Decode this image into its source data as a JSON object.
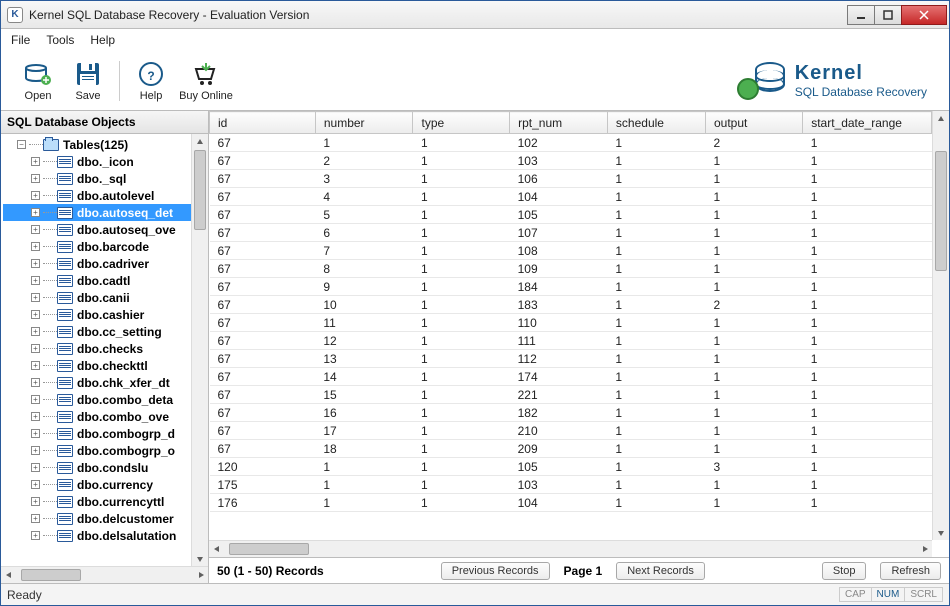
{
  "window": {
    "title": "Kernel SQL Database Recovery - Evaluation Version"
  },
  "menu": {
    "file": "File",
    "tools": "Tools",
    "help": "Help"
  },
  "toolbar": {
    "open": "Open",
    "save": "Save",
    "help": "Help",
    "buy": "Buy Online"
  },
  "brand": {
    "name": "Kernel",
    "product": "SQL Database Recovery"
  },
  "left": {
    "header": "SQL Database Objects",
    "root": "Tables(125)",
    "items": [
      "dbo._icon",
      "dbo._sql",
      "dbo.autolevel",
      "dbo.autoseq_det",
      "dbo.autoseq_ove",
      "dbo.barcode",
      "dbo.cadriver",
      "dbo.cadtl",
      "dbo.canii",
      "dbo.cashier",
      "dbo.cc_setting",
      "dbo.checks",
      "dbo.checkttl",
      "dbo.chk_xfer_dt",
      "dbo.combo_deta",
      "dbo.combo_ove",
      "dbo.combogrp_d",
      "dbo.combogrp_o",
      "dbo.condslu",
      "dbo.currency",
      "dbo.currencyttl",
      "dbo.delcustomer",
      "dbo.delsalutation"
    ],
    "selected_index": 3
  },
  "grid": {
    "columns": [
      "id",
      "number",
      "type",
      "rpt_num",
      "schedule",
      "output",
      "start_date_range"
    ],
    "rows": [
      [
        67,
        1,
        1,
        102,
        1,
        2,
        1
      ],
      [
        67,
        2,
        1,
        103,
        1,
        1,
        1
      ],
      [
        67,
        3,
        1,
        106,
        1,
        1,
        1
      ],
      [
        67,
        4,
        1,
        104,
        1,
        1,
        1
      ],
      [
        67,
        5,
        1,
        105,
        1,
        1,
        1
      ],
      [
        67,
        6,
        1,
        107,
        1,
        1,
        1
      ],
      [
        67,
        7,
        1,
        108,
        1,
        1,
        1
      ],
      [
        67,
        8,
        1,
        109,
        1,
        1,
        1
      ],
      [
        67,
        9,
        1,
        184,
        1,
        1,
        1
      ],
      [
        67,
        10,
        1,
        183,
        1,
        2,
        1
      ],
      [
        67,
        11,
        1,
        110,
        1,
        1,
        1
      ],
      [
        67,
        12,
        1,
        111,
        1,
        1,
        1
      ],
      [
        67,
        13,
        1,
        112,
        1,
        1,
        1
      ],
      [
        67,
        14,
        1,
        174,
        1,
        1,
        1
      ],
      [
        67,
        15,
        1,
        221,
        1,
        1,
        1
      ],
      [
        67,
        16,
        1,
        182,
        1,
        1,
        1
      ],
      [
        67,
        17,
        1,
        210,
        1,
        1,
        1
      ],
      [
        67,
        18,
        1,
        209,
        1,
        1,
        1
      ],
      [
        120,
        1,
        1,
        105,
        1,
        3,
        1
      ],
      [
        175,
        1,
        1,
        103,
        1,
        1,
        1
      ],
      [
        176,
        1,
        1,
        104,
        1,
        1,
        1
      ]
    ]
  },
  "pager": {
    "count": "50 (1 - 50) Records",
    "prev": "Previous Records",
    "page": "Page 1",
    "next": "Next Records",
    "stop": "Stop",
    "refresh": "Refresh"
  },
  "status": {
    "ready": "Ready",
    "cap": "CAP",
    "num": "NUM",
    "scrl": "SCRL"
  }
}
